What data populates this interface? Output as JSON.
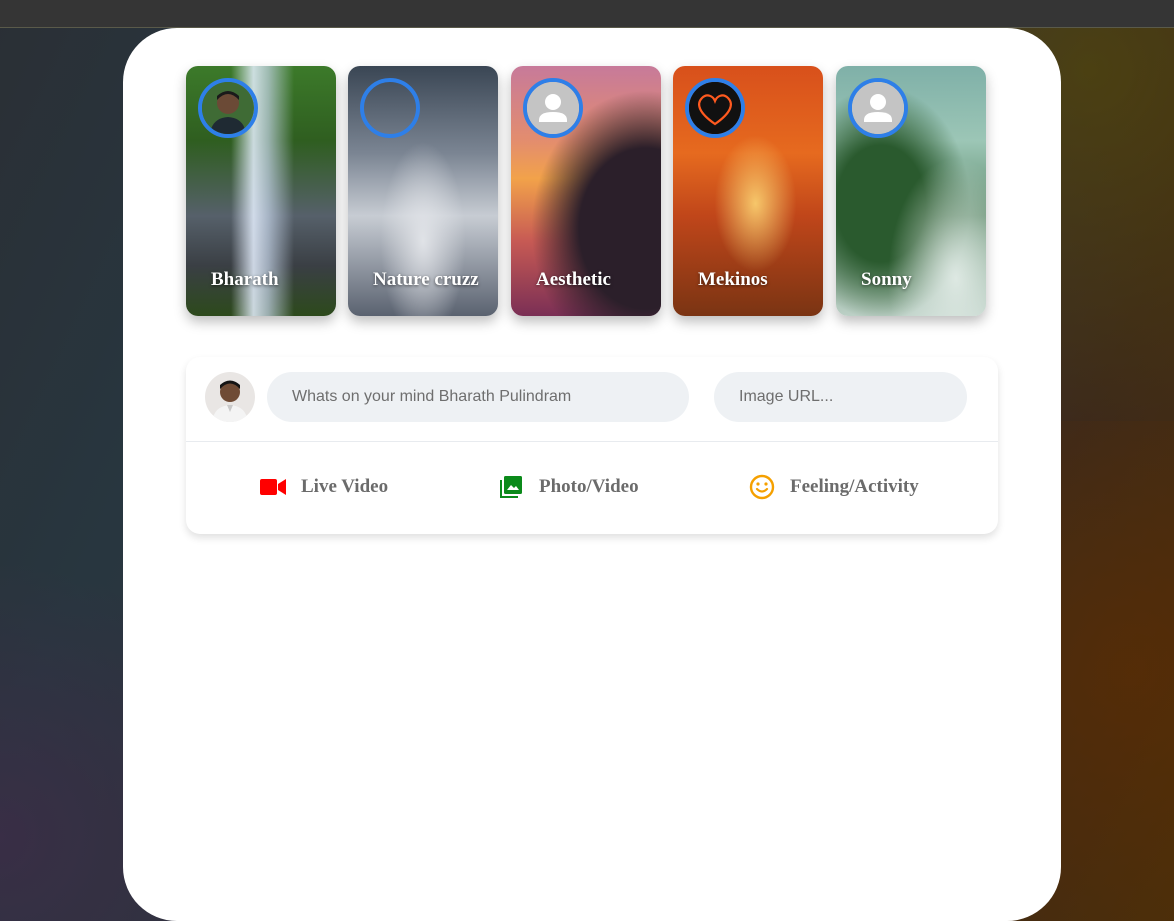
{
  "stories": [
    {
      "name": "Bharath",
      "background": "waterfall",
      "avatar": "profile-photo"
    },
    {
      "name": "Nature cruzz",
      "background": "snowy-forest",
      "avatar": "empty-ring"
    },
    {
      "name": "Aesthetic",
      "background": "sunset-wave",
      "avatar": "default-person-icon"
    },
    {
      "name": "Mekinos",
      "background": "autumn-tree",
      "avatar": "heart-icon"
    },
    {
      "name": "Sonny",
      "background": "misty-forest",
      "avatar": "default-person-icon"
    }
  ],
  "composer": {
    "post_placeholder": "Whats on your mind Bharath Pulindram",
    "image_url_placeholder": "Image URL..."
  },
  "actions": [
    {
      "label": "Live Video",
      "icon": "video-camera-icon",
      "color": "#ff0000"
    },
    {
      "label": "Photo/Video",
      "icon": "photo-library-icon",
      "color": "#008000"
    },
    {
      "label": "Feeling/Activity",
      "icon": "smiley-icon",
      "color": "#f5a000"
    }
  ],
  "colors": {
    "story_ring": "#2e7fe8",
    "input_background": "#eef1f4",
    "card_background": "#ffffff"
  }
}
